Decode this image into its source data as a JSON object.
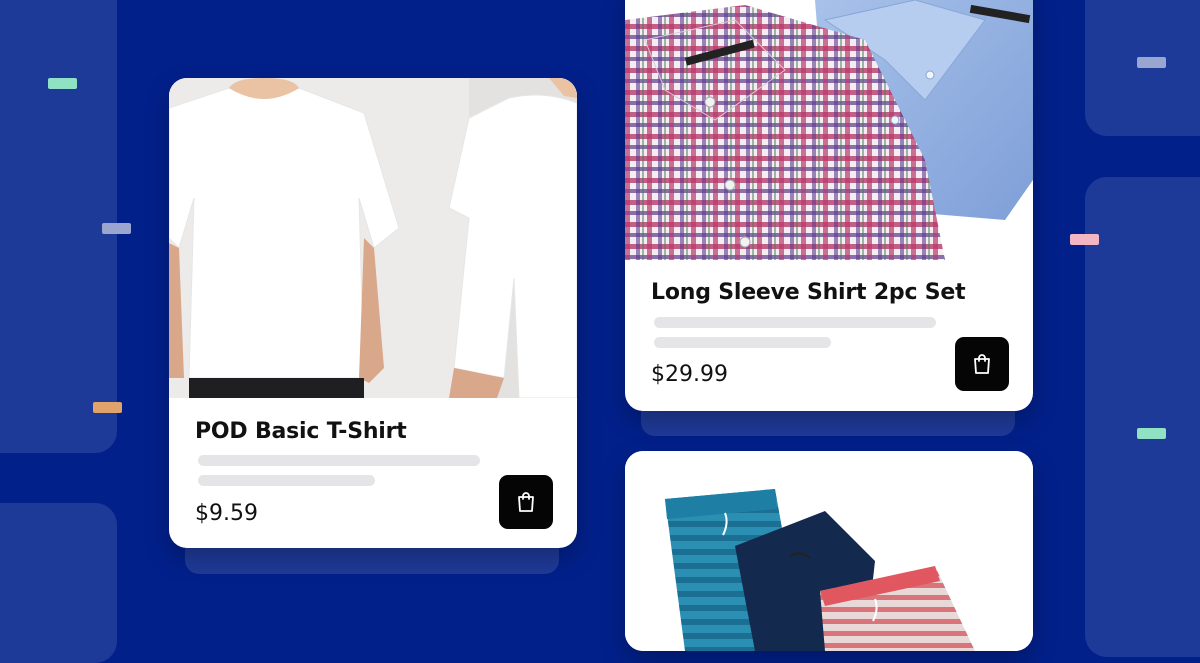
{
  "products": [
    {
      "title": "POD Basic T-Shirt",
      "price": "$9.59"
    },
    {
      "title": "Long Sleeve Shirt 2pc Set",
      "price": "$29.99"
    },
    {
      "title": "",
      "price": ""
    }
  ],
  "icons": {
    "cart": "shopping-bag-icon"
  },
  "colors": {
    "background": "#02208a",
    "panel": "#1e3a99",
    "accent_mint": "#8fe3c4",
    "accent_orange": "#e0a36b",
    "accent_pink": "#f5b6c3",
    "accent_gray": "#9aa6cf",
    "button": "#050505"
  }
}
